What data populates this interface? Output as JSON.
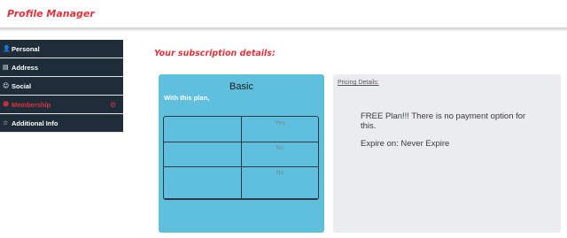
{
  "app": {
    "title": "Profile Manager"
  },
  "sidebar": {
    "items": [
      {
        "label": "Personal",
        "icon": "person-icon",
        "active": false
      },
      {
        "label": "Address",
        "icon": "id-card-icon",
        "active": false
      },
      {
        "label": "Social",
        "icon": "group-icon",
        "active": false
      },
      {
        "label": "Membership",
        "icon": "person-plus-icon",
        "active": true
      },
      {
        "label": "Additional Info",
        "icon": "star-icon",
        "active": false
      }
    ],
    "active_color": "#e0323a",
    "background_color": "#1f2d3a"
  },
  "main": {
    "section_title": "Your subscription details:",
    "plan": {
      "name": "Basic",
      "subtitle": "With this plan,",
      "features": [
        {
          "value": "Yes"
        },
        {
          "value": "No"
        },
        {
          "value": "No"
        }
      ],
      "card_color": "#5fc0de"
    },
    "pricing": {
      "label": "Pricing Details:",
      "message": "FREE Plan!!! There is no payment option for this.",
      "expiry": "Expire on: Never Expire"
    }
  },
  "colors": {
    "accent": "#e0323a"
  }
}
